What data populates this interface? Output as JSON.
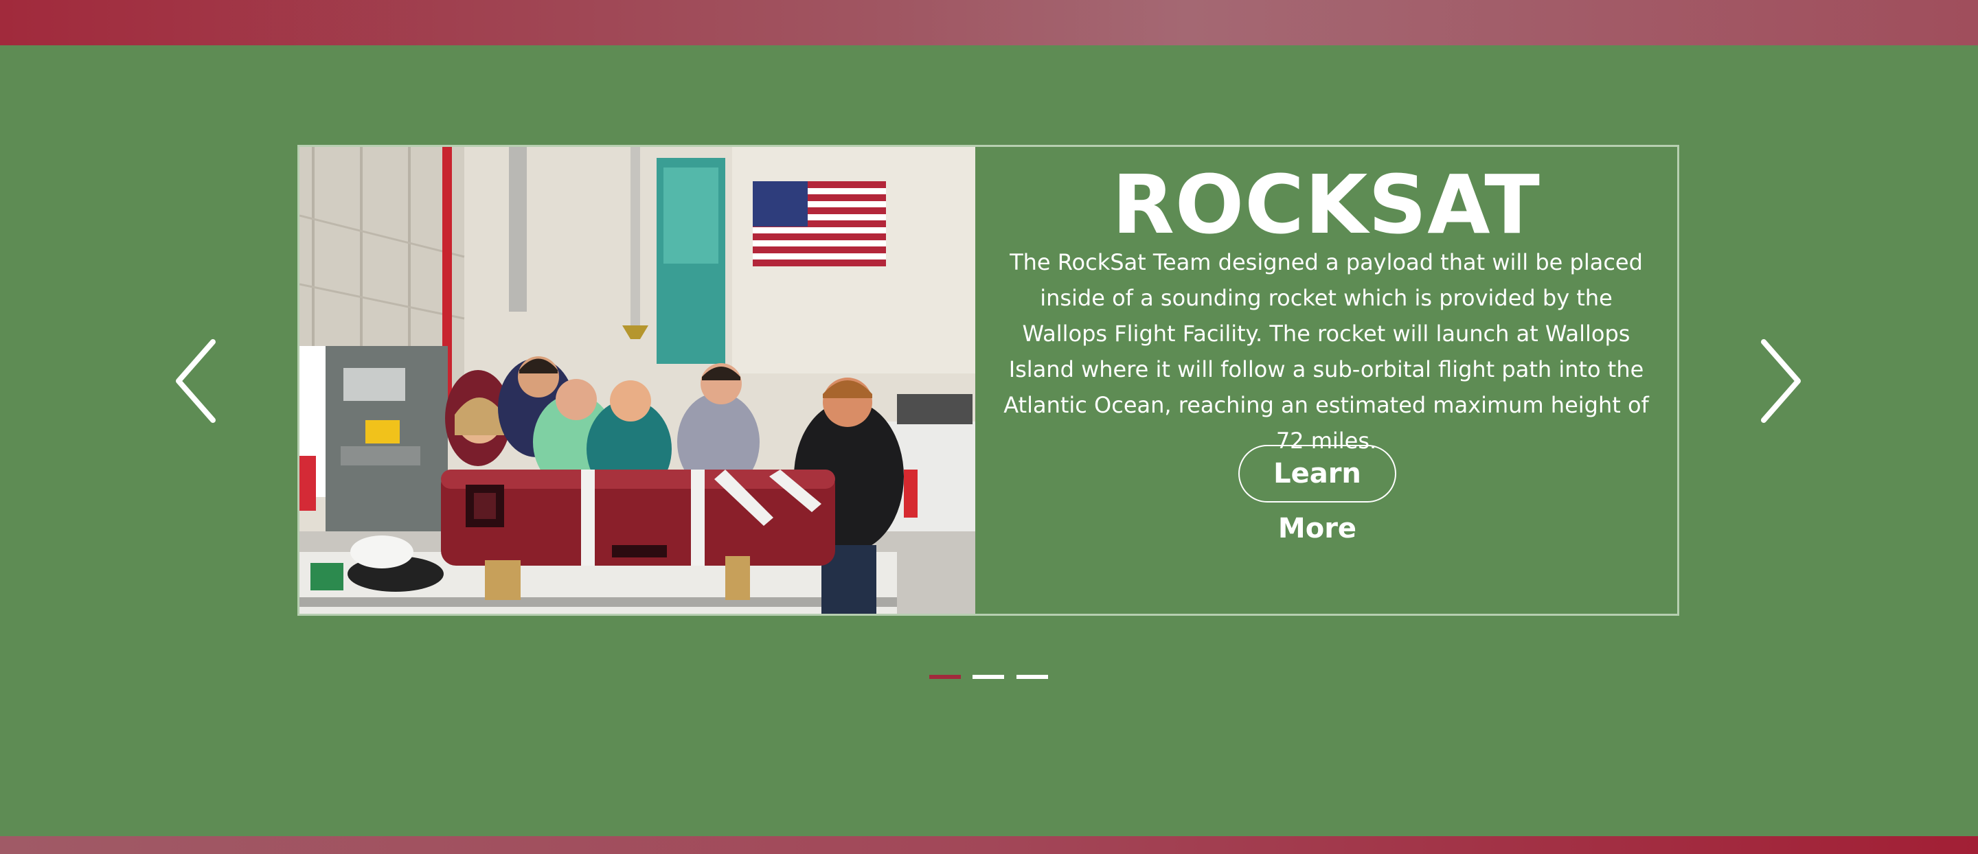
{
  "slide": {
    "title": "ROCKSAT",
    "description": "The RockSat Team designed a payload that will be placed inside of a sounding rocket which is provided by the Wallops Flight Facility. The rocket will launch at Wallops Island where it will follow a sub-orbital flight path into the Atlantic Ocean, reaching an estimated maximum height of 72 miles.",
    "button_label": "Learn More",
    "image_alt": "RockSat team members posing behind a signed red rocket payload section in a hangar"
  },
  "carousel": {
    "prev_icon": "chevron-left-icon",
    "next_icon": "chevron-right-icon",
    "indicators": [
      {
        "active": true
      },
      {
        "active": false
      },
      {
        "active": false
      }
    ],
    "active_index": 0
  },
  "colors": {
    "background": "#5e8c54",
    "accent": "#a12a3c",
    "text": "#ffffff",
    "frame_border": "#b7cfb1"
  }
}
